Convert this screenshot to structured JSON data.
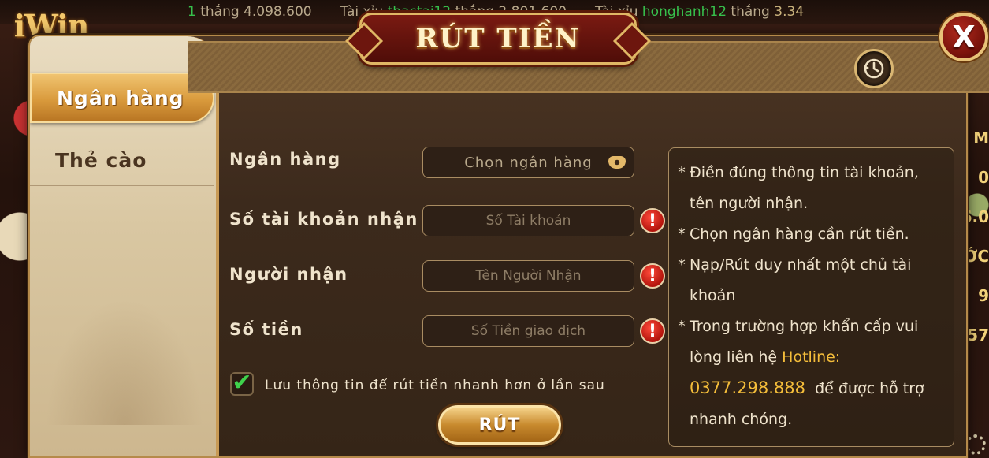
{
  "ticker": [
    {
      "prefix": "1",
      "label": "thắng",
      "amount": "4.098.600"
    },
    {
      "game": "Tài xỉu",
      "user": "thactai12",
      "label": "thắng",
      "amount": "2.801.600"
    },
    {
      "game": "Tài xỉu",
      "user": "honghanh12",
      "label": "thắng",
      "amount": "3.34"
    }
  ],
  "logo": "iWin",
  "title": "RÚT TIỀN",
  "close_label": "X",
  "tabs": [
    {
      "label": "Ngân hàng",
      "active": true
    },
    {
      "label": "Thẻ cào",
      "active": false
    }
  ],
  "form": {
    "bank": {
      "label": "Ngân hàng",
      "value": "Chọn ngân hàng"
    },
    "account": {
      "label": "Số tài khoản nhận",
      "placeholder": "Số Tài khoản"
    },
    "recipient": {
      "label": "Người nhận",
      "placeholder": "Tên Người Nhận"
    },
    "amount": {
      "label": "Số tiền",
      "placeholder": "Số Tiền giao dịch"
    },
    "warn_glyph": "!",
    "remember": {
      "checked": true,
      "label": "Lưu thông tin để rút tiền nhanh hơn ở lần sau"
    },
    "submit_label": "RÚT"
  },
  "notes": {
    "n1": "Điền đúng thông tin tài khoản, tên người nhận.",
    "n2": "Chọn ngân hàng cần rút tiền.",
    "n3": "Nạp/Rút duy nhất một chủ tài khoản",
    "n4_before": "Trong trường hợp khẩn cấp vui lòng liên hệ",
    "n4_hotline_label": "Hotline:",
    "n4_number": "0377.298.888",
    "n4_after": "để được hỗ trợ nhanh chóng."
  },
  "right_strip": [
    "M",
    "0",
    "6.0",
    "ỚC",
    "9",
    "57"
  ],
  "colors": {
    "gold": "#e0b765",
    "accent_tab": "#d99a3c",
    "title_red": "#7a1a12",
    "hotline": "#f4bd3a",
    "check_green": "#3fd24c",
    "warn_red": "#b3140c"
  },
  "icons": [
    "history-icon",
    "chevron-down-icon",
    "warning-icon",
    "check-icon",
    "close-icon"
  ]
}
